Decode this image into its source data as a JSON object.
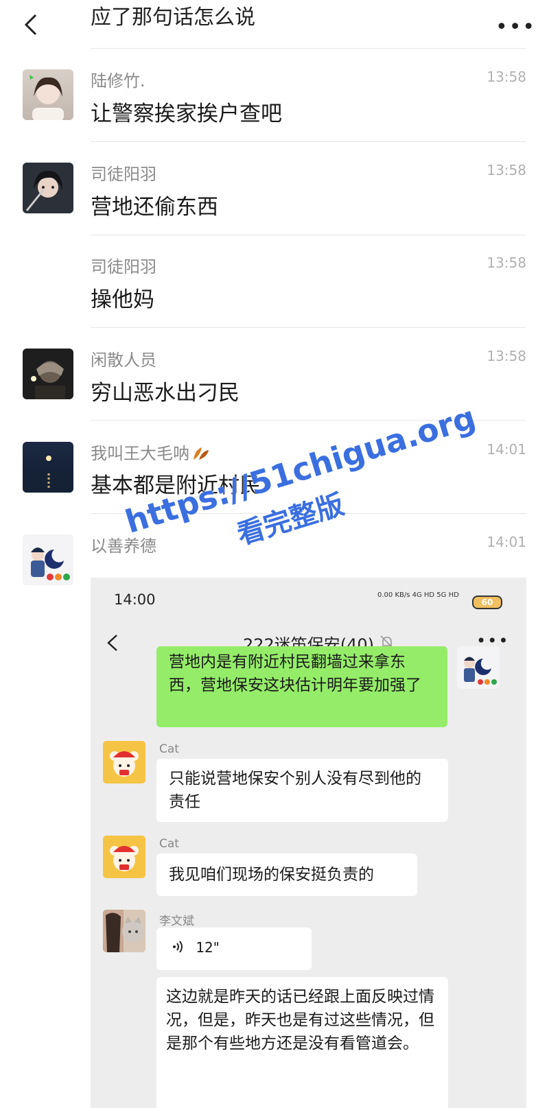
{
  "header": {
    "title": "应了那句话怎么说"
  },
  "messages": [
    {
      "sender": "陆修竹.",
      "text": "让警察挨家挨户查吧",
      "time": "13:58"
    },
    {
      "sender": "司徒阳羽",
      "text": "营地还偷东西",
      "time": "13:58"
    },
    {
      "sender": "司徒阳羽",
      "text": "操他妈",
      "time": "13:58"
    },
    {
      "sender": "闲散人员",
      "text": "穷山恶水出刁民",
      "time": "13:58"
    },
    {
      "sender": "我叫王大毛呐",
      "text": "基本都是附近村民",
      "time": "14:01"
    },
    {
      "sender": "以善养德",
      "time": "14:01"
    }
  ],
  "screenshot": {
    "status_time": "14:00",
    "status_net": "0.00 KB/s  4G HD  5G HD",
    "battery": "60",
    "group_title": "222迷笛保安(40)",
    "messages": [
      {
        "text": "营地内是有附近村民翻墙过来拿东西，营地保安这块估计明年要加强了"
      },
      {
        "sender": "Cat",
        "text": "只能说营地保安个别人没有尽到他的责任"
      },
      {
        "sender": "Cat",
        "text": "我见咱们现场的保安挺负责的"
      },
      {
        "sender": "李文斌",
        "voice": "12\""
      },
      {
        "text": "这边就是昨天的话已经跟上面反映过情况，但是，昨天也是有过这些情况，但是那个有些地方还是没有看管道会。"
      }
    ]
  },
  "watermark": {
    "line1": "https://51chigua.org",
    "line2": "看完整版"
  },
  "colors": {
    "accent_green": "#95ec69",
    "watermark_blue": "#3b6fe0"
  }
}
